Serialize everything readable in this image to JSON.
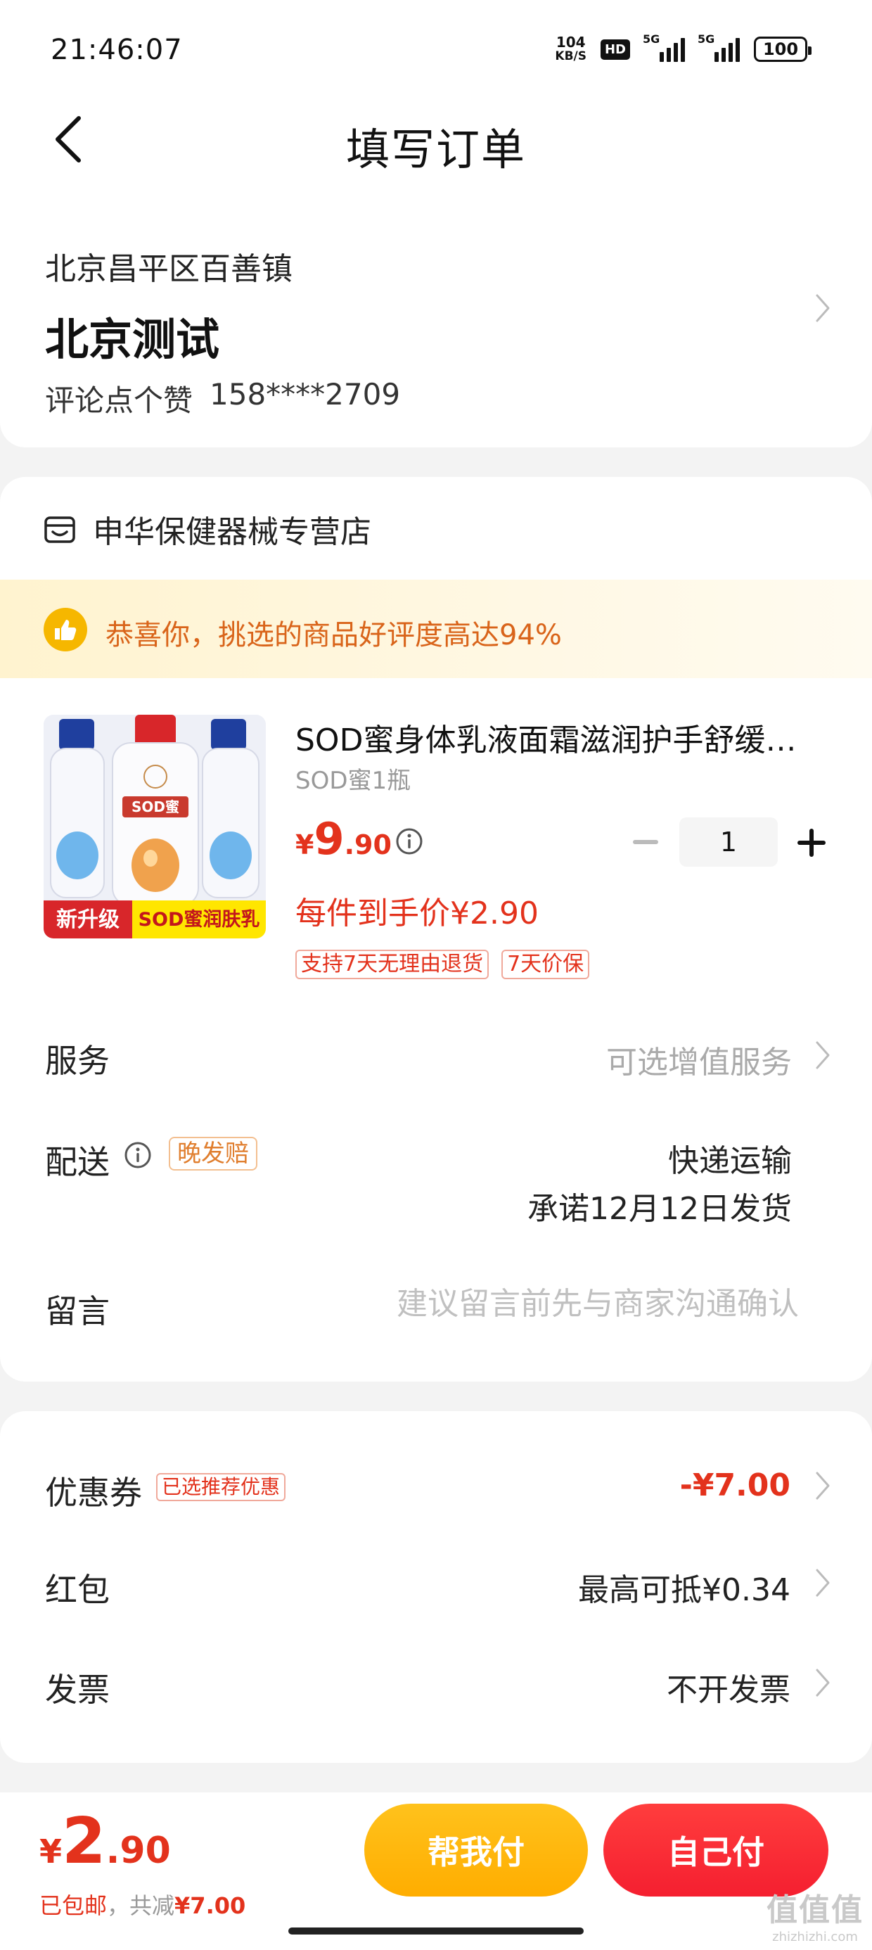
{
  "status_bar": {
    "time": "21:46:07",
    "net_speed_value": "104",
    "net_speed_unit": "KB/S",
    "hd_badge": "HD",
    "signal_1": "5G",
    "signal_2": "5G",
    "battery": "100"
  },
  "navbar": {
    "back_icon": "chevron-left-icon",
    "title": "填写订单"
  },
  "address": {
    "region": "北京昌平区百善镇",
    "name": "北京测试",
    "contact_name": "评论点个赞",
    "phone": "158****2709"
  },
  "store": {
    "icon": "store-icon",
    "name": "申华保健器械专营店"
  },
  "rating_banner": {
    "icon": "thumbs-up-icon",
    "text": "恭喜你，挑选的商品好评度高达94%"
  },
  "product": {
    "image_label_left": "新升级",
    "image_label_right": "SOD蜜润肤乳",
    "bottle_label": "SOD蜜",
    "title": "SOD蜜身体乳液面霜滋润护手舒缓…",
    "spec": "SOD蜜1瓶",
    "price_yen": "¥",
    "price_int": "9",
    "price_dec": ".90",
    "quantity": "1",
    "unit_price": "每件到手价¥2.90",
    "tags": [
      "支持7天无理由退货",
      "7天价保"
    ]
  },
  "rows": {
    "service_label": "服务",
    "service_value": "可选增值服务",
    "delivery_label": "配送",
    "late_badge": "晚发赔",
    "delivery_method": "快递运输",
    "delivery_promise": "承诺12月12日发货",
    "message_label": "留言",
    "message_placeholder": "建议留言前先与商家沟通确认"
  },
  "discounts": {
    "coupon_label": "优惠券",
    "coupon_badge": "已选推荐优惠",
    "coupon_value": "-¥7.00",
    "redpack_label": "红包",
    "redpack_value": "最高可抵¥0.34",
    "invoice_label": "发票",
    "invoice_value": "不开发票"
  },
  "bottom": {
    "total_yen": "¥",
    "total_int": "2",
    "total_dec": ".90",
    "free_shipping": "已包邮",
    "saved_prefix": "，共减",
    "saved_amount": "¥7.00",
    "pay_help": "帮我付",
    "pay_self": "自己付"
  },
  "watermark": {
    "logo": "值值值",
    "url": "zhizhizhi.com"
  },
  "colors": {
    "accent_red": "#e3321c",
    "banner_orange": "#d9641a",
    "button_yellow": "#ffb300",
    "button_red": "#f5222d"
  }
}
